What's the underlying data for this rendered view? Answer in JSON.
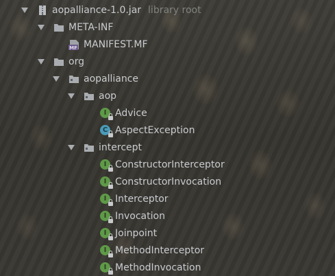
{
  "tree": {
    "root": {
      "label": "aopalliance-1.0.jar",
      "secondary": "library root",
      "icon": "jar-icon"
    },
    "meta_inf": {
      "label": "META-INF",
      "icon": "folder-icon"
    },
    "manifest": {
      "label": "MANIFEST.MF",
      "icon": "manifest-file-icon",
      "badge": "MF"
    },
    "org": {
      "label": "org",
      "icon": "folder-icon"
    },
    "aopalliance": {
      "label": "aopalliance",
      "icon": "package-icon"
    },
    "aop": {
      "label": "aop",
      "icon": "package-icon"
    },
    "aop_items": [
      {
        "label": "Advice",
        "kind": "interface",
        "badge": "I"
      },
      {
        "label": "AspectException",
        "kind": "class",
        "badge": "C"
      }
    ],
    "intercept": {
      "label": "intercept",
      "icon": "package-icon"
    },
    "intercept_items": [
      {
        "label": "ConstructorInterceptor",
        "kind": "interface",
        "badge": "I"
      },
      {
        "label": "ConstructorInvocation",
        "kind": "interface",
        "badge": "I"
      },
      {
        "label": "Interceptor",
        "kind": "interface",
        "badge": "I"
      },
      {
        "label": "Invocation",
        "kind": "interface",
        "badge": "I"
      },
      {
        "label": "Joinpoint",
        "kind": "interface",
        "badge": "I"
      },
      {
        "label": "MethodInterceptor",
        "kind": "interface",
        "badge": "I"
      },
      {
        "label": "MethodInvocation",
        "kind": "interface",
        "badge": "I"
      }
    ]
  },
  "colors": {
    "interface_badge": "#5e9a47",
    "class_badge": "#4a9bb8",
    "text": "#c9ccd1",
    "secondary_text": "#80827f"
  }
}
